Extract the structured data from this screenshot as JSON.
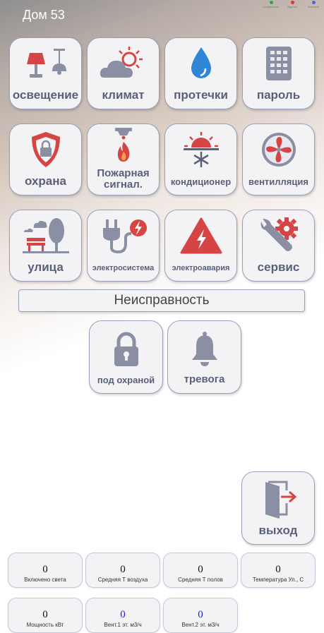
{
  "app": {
    "title": "Дом 53"
  },
  "corner": [
    {
      "label": "Соединение",
      "color": "#2ea84a"
    },
    {
      "label": "Журнал",
      "color": "#d43a2a"
    },
    {
      "label": "Фоновое",
      "color": "#4a6ad0"
    }
  ],
  "tiles": [
    {
      "label": "освещение",
      "icon": "lamp-icon"
    },
    {
      "label": "климат",
      "icon": "weather-icon"
    },
    {
      "label": "протечки",
      "icon": "water-drop-icon"
    },
    {
      "label": "пароль",
      "icon": "keypad-icon"
    },
    {
      "label": "охрана",
      "icon": "shield-lock-icon"
    },
    {
      "label": "Пожарная сигнал.",
      "icon": "fire-alarm-icon"
    },
    {
      "label": "кондиционер",
      "icon": "sun-snowflake-icon"
    },
    {
      "label": "вентилляция",
      "icon": "fan-icon"
    },
    {
      "label": "улица",
      "icon": "park-icon"
    },
    {
      "label": "электросистема",
      "icon": "plug-icon"
    },
    {
      "label": "электроавария",
      "icon": "high-voltage-icon"
    },
    {
      "label": "сервис",
      "icon": "wrench-gear-icon"
    }
  ],
  "fault_label": "Неисправность",
  "status": {
    "armed": {
      "label": "под охраной",
      "icon": "lock-icon"
    },
    "alarm": {
      "label": "тревога",
      "icon": "bell-icon"
    }
  },
  "exit": {
    "label": "выход",
    "icon": "exit-door-icon"
  },
  "sensors": [
    {
      "value": "0",
      "label": "Включено света"
    },
    {
      "value": "0",
      "label": "Средняя Т воздуха"
    },
    {
      "value": "0",
      "label": "Средняя Т полов"
    },
    {
      "value": "0",
      "label": "Температура Ул., С"
    },
    {
      "value": "0",
      "label": "Мощность кВт"
    },
    {
      "value": "0",
      "label": "Вент.1 эт. м3/ч"
    },
    {
      "value": "0",
      "label": "Вент.2 эт. м3/ч"
    }
  ],
  "colors": {
    "accent_red": "#d64545",
    "icon_gray": "#8a8fa3",
    "accent_blue": "#2f86d6"
  }
}
